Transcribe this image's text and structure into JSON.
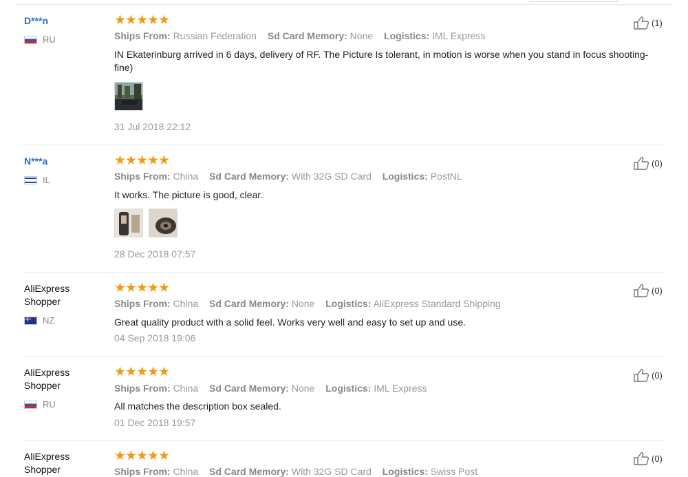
{
  "reviews": [
    {
      "user": "D***n",
      "country": "RU",
      "ships_from_label": "Ships From:",
      "ships_from": "Russian Federation",
      "memory_label": "Sd Card Memory:",
      "memory": "None",
      "logistics_label": "Logistics:",
      "logistics": "IML Express",
      "text": "IN Ekaterinburg arrived in 6 days, delivery of RF. The Picture Is tolerant, in motion is worse when you stand in focus shooting-fine)",
      "date": "31 Jul 2018 22:12",
      "likes": "(1)",
      "rating": 5
    },
    {
      "user": "N***a",
      "country": "IL",
      "ships_from_label": "Ships From:",
      "ships_from": "China",
      "memory_label": "Sd Card Memory:",
      "memory": "With 32G SD Card",
      "logistics_label": "Logistics:",
      "logistics": "PostNL",
      "text": "It works. The picture is good, clear.",
      "date": "28 Dec 2018 07:57",
      "likes": "(0)",
      "rating": 5
    },
    {
      "user": "AliExpress Shopper",
      "country": "NZ",
      "ships_from_label": "Ships From:",
      "ships_from": "China",
      "memory_label": "Sd Card Memory:",
      "memory": "None",
      "logistics_label": "Logistics:",
      "logistics": "AliExpress Standard Shipping",
      "text": "Great quality product with a solid feel. Works very well and easy to set up and use.",
      "date": "04 Sep 2018 19:06",
      "likes": "(0)",
      "rating": 5
    },
    {
      "user": "AliExpress Shopper",
      "country": "RU",
      "ships_from_label": "Ships From:",
      "ships_from": "China",
      "memory_label": "Sd Card Memory:",
      "memory": "None",
      "logistics_label": "Logistics:",
      "logistics": "IML Express",
      "text": "All matches the description box sealed.",
      "date": "01 Dec 2018 19:57",
      "likes": "(0)",
      "rating": 5
    },
    {
      "user": "AliExpress Shopper",
      "country": "",
      "ships_from_label": "Ships From:",
      "ships_from": "China",
      "memory_label": "Sd Card Memory:",
      "memory": "With 32G SD Card",
      "logistics_label": "Logistics:",
      "logistics": "Swiss Post",
      "likes": "(0)",
      "rating": 5
    }
  ],
  "stars_glyph": "★★★★★",
  "colors": {
    "star": "#f29a12",
    "link_user": "#2a6ebb",
    "muted": "#999999"
  },
  "icons": {
    "like": "thumbs-up-icon"
  }
}
